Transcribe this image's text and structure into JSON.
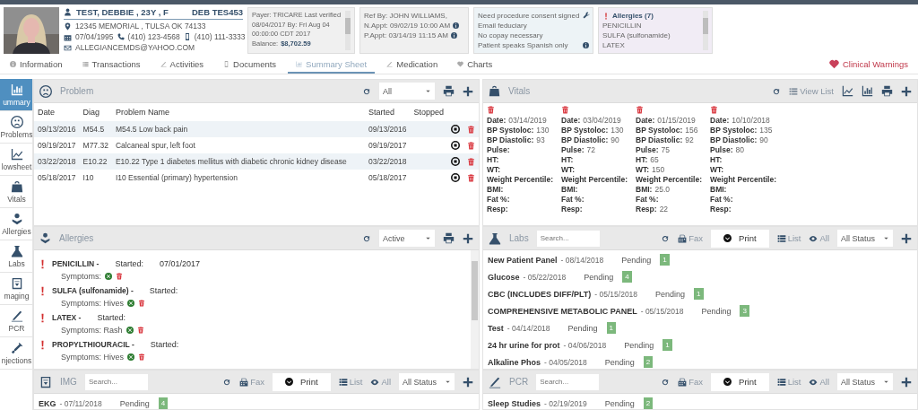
{
  "patient": {
    "name": "TEST, DEBBIE , 23Y , F",
    "code": "DEB TES453",
    "address": "12345 MEMORIAL , TULSA OK 74133",
    "dob": "07/04/1995",
    "phone": "(410) 123-4568",
    "mobile": "(410) 111-3333",
    "email": "ALLEGIANCEMDS@YAHOO.COM"
  },
  "payer_card": {
    "text": "Payer: TRICARE Last verified 08/04/2017 By: Fri Aug 04 00:00:00 CDT 2017",
    "balance_label": "Balance:",
    "balance": "$8,702.59"
  },
  "referral_card": {
    "ref": "Ref By: JOHN WILLIAMS,",
    "next_appt": "N.Appt: 09/02/19 10:00 AM",
    "prev_appt": "P.Appt: 03/14/19 11:15 AM"
  },
  "notes_card": {
    "lines": [
      "Need procedure consent signed",
      "Email feduciary",
      "No copay necessary",
      "Patient speaks Spanish only"
    ]
  },
  "allergy_card": {
    "title": "Allergies (7)",
    "items": [
      "PENICILLIN",
      "SULFA (sulfonamide)",
      "LATEX"
    ]
  },
  "tabs": [
    {
      "label": "Information",
      "selected": false
    },
    {
      "label": "Transactions",
      "selected": false
    },
    {
      "label": "Activities",
      "selected": false
    },
    {
      "label": "Documents",
      "selected": false
    },
    {
      "label": "Summary Sheet",
      "selected": true
    },
    {
      "label": "Medication",
      "selected": false
    },
    {
      "label": "Charts",
      "selected": false
    }
  ],
  "clinical_warnings": "Clinical Warnings",
  "sidebar": [
    {
      "label": "ummary",
      "selected": true
    },
    {
      "label": "Problems",
      "selected": false
    },
    {
      "label": "lowsheet",
      "selected": false
    },
    {
      "label": "Vitals",
      "selected": false
    },
    {
      "label": "Allergies",
      "selected": false
    },
    {
      "label": "Labs",
      "selected": false
    },
    {
      "label": "maging",
      "selected": false
    },
    {
      "label": "PCR",
      "selected": false
    },
    {
      "label": "njections",
      "selected": false
    }
  ],
  "problem_panel": {
    "title": "Problem",
    "filter": "All",
    "columns": [
      "Date",
      "Diag",
      "Problem Name",
      "Started",
      "Stopped"
    ],
    "rows": [
      {
        "date": "09/13/2016",
        "diag": "M54.5",
        "name": "M54.5 Low back pain",
        "started": "09/13/2016"
      },
      {
        "date": "09/19/2017",
        "diag": "M77.32",
        "name": "Calcaneal spur, left foot",
        "started": "09/19/2017"
      },
      {
        "date": "03/22/2018",
        "diag": "E10.22",
        "name": "E10.22 Type 1 diabetes mellitus with diabetic chronic kidney disease",
        "started": "03/22/2018"
      },
      {
        "date": "05/18/2017",
        "diag": "I10",
        "name": "I10 Essential (primary) hypertension",
        "started": "05/18/2017"
      }
    ]
  },
  "vitals_panel": {
    "title": "Vitals",
    "view_list": "View List",
    "records": [
      {
        "fields": [
          {
            "label": "Date:",
            "value": "03/14/2019"
          },
          {
            "label": "BP Systoloc:",
            "value": "130"
          },
          {
            "label": "BP Diastolic:",
            "value": "93"
          },
          {
            "label": "Pulse:"
          },
          {
            "label": "HT:"
          },
          {
            "label": "WT:"
          },
          {
            "label": "Weight Percentile:"
          },
          {
            "label": "BMI:"
          },
          {
            "label": "Fat %:"
          },
          {
            "label": "Resp:"
          }
        ]
      },
      {
        "fields": [
          {
            "label": "Date:",
            "value": "03/04/2019"
          },
          {
            "label": "BP Systoloc:",
            "value": "130"
          },
          {
            "label": "BP Diastolic:",
            "value": "90"
          },
          {
            "label": "Pulse:",
            "value": "72"
          },
          {
            "label": "HT:"
          },
          {
            "label": "WT:"
          },
          {
            "label": "Weight Percentile:"
          },
          {
            "label": "BMI:"
          },
          {
            "label": "Fat %:"
          },
          {
            "label": "Resp:"
          }
        ]
      },
      {
        "fields": [
          {
            "label": "Date:",
            "value": "01/15/2019"
          },
          {
            "label": "BP Systoloc:",
            "value": "156"
          },
          {
            "label": "BP Diastolic:",
            "value": "92"
          },
          {
            "label": "Pulse:",
            "value": "75"
          },
          {
            "label": "HT:",
            "value": "65"
          },
          {
            "label": "WT:",
            "value": "150"
          },
          {
            "label": "Weight Percentile:"
          },
          {
            "label": "BMI:",
            "value": "25.0"
          },
          {
            "label": "Fat %:"
          },
          {
            "label": "Resp:",
            "value": "22"
          }
        ]
      },
      {
        "fields": [
          {
            "label": "Date:",
            "value": "10/10/2018"
          },
          {
            "label": "BP Systoloc:",
            "value": "135"
          },
          {
            "label": "BP Diastolic:",
            "value": "90"
          },
          {
            "label": "Pulse:",
            "value": "80"
          },
          {
            "label": "HT:"
          },
          {
            "label": "WT:"
          },
          {
            "label": "Weight Percentile:"
          },
          {
            "label": "BMI:"
          },
          {
            "label": "Fat %:"
          },
          {
            "label": "Resp:"
          }
        ]
      }
    ]
  },
  "allergies_panel": {
    "title": "Allergies",
    "filter": "Active",
    "items": [
      {
        "name": "PENICILLIN -",
        "started_label": "Started:",
        "started": "07/01/2017",
        "symptoms": "Symptoms:"
      },
      {
        "name": "SULFA (sulfonamide) -",
        "started_label": "Started:",
        "symptoms": "Symptoms: Hives"
      },
      {
        "name": "LATEX -",
        "started_label": "Started:",
        "symptoms": "Symptoms: Rash"
      },
      {
        "name": "PROPYLTHIOURACIL -",
        "started_label": "Started:",
        "symptoms": "Symptoms: Hives"
      }
    ]
  },
  "labs_panel": {
    "title": "Labs",
    "search_placeholder": "Search...",
    "fax": "Fax",
    "print": "Print",
    "list": "List",
    "all": "All",
    "status": "All Status",
    "items": [
      {
        "name": "New Patient Panel",
        "date": "- 08/14/2018",
        "status": "Pending",
        "count": "1"
      },
      {
        "name": "Glucose",
        "date": "- 05/22/2018",
        "status": "Pending",
        "count": "4"
      },
      {
        "name": "CBC (INCLUDES DIFF/PLT)",
        "date": "- 05/15/2018",
        "status": "Pending",
        "count": "1"
      },
      {
        "name": "COMPREHENSIVE METABOLIC PANEL",
        "date": "- 05/15/2018",
        "status": "Pending",
        "count": "3"
      },
      {
        "name": "Test",
        "date": "- 04/14/2018",
        "status": "Pending",
        "count": "1"
      },
      {
        "name": "24 hr urine for prot",
        "date": "- 04/06/2018",
        "status": "Pending",
        "count": "1"
      },
      {
        "name": "Alkaline Phos",
        "date": "- 04/05/2018",
        "status": "Pending",
        "count": "2"
      }
    ]
  },
  "img_panel": {
    "title": "IMG",
    "search_placeholder": "Search...",
    "fax": "Fax",
    "print": "Print",
    "list": "List",
    "all": "All",
    "status": "All Status",
    "items": [
      {
        "name": "EKG",
        "date": "- 07/11/2018",
        "status": "Pending",
        "count": "4"
      }
    ]
  },
  "pcr_panel": {
    "title": "PCR",
    "search_placeholder": "Search...",
    "fax": "Fax",
    "print": "Print",
    "list": "List",
    "all": "All",
    "status": "All Status",
    "items": [
      {
        "name": "Sleep Studies",
        "date": "- 02/19/2019",
        "status": "Pending",
        "count": "2"
      }
    ]
  }
}
